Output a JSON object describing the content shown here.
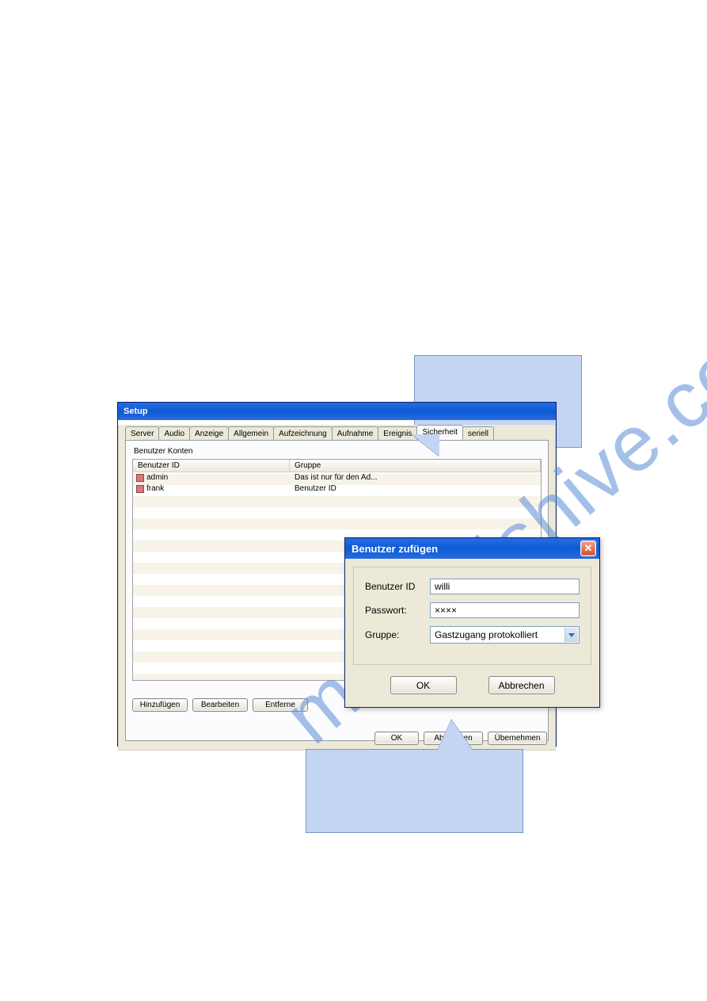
{
  "watermark": "manualshive.com",
  "setup": {
    "title": "Setup",
    "tabs": [
      "Server",
      "Audio",
      "Anzeige",
      "Allgemein",
      "Aufzeichnung",
      "Aufnahme",
      "Ereignis",
      "Sicherheit",
      "seriell"
    ],
    "active_tab_index": 7,
    "group_label": "Benutzer Konten",
    "columns": {
      "id": "Benutzer ID",
      "group": "Gruppe"
    },
    "rows": [
      {
        "id": "admin",
        "group": "Das ist nur für den Ad..."
      },
      {
        "id": "frank",
        "group": "Benutzer ID"
      }
    ],
    "buttons": {
      "add": "Hinzufügen",
      "edit": "Bearbeiten",
      "remove": "Entferne"
    },
    "dialog_buttons": {
      "ok": "OK",
      "cancel": "Abbrechen",
      "apply": "Übernehmen"
    }
  },
  "modal": {
    "title": "Benutzer zufügen",
    "fields": {
      "user_id": {
        "label": "Benutzer ID",
        "value": "willi"
      },
      "password": {
        "label": "Passwort:",
        "value": "××××"
      },
      "group": {
        "label": "Gruppe:",
        "value": "Gastzugang protokolliert"
      }
    },
    "buttons": {
      "ok": "OK",
      "cancel": "Abbrechen"
    }
  }
}
